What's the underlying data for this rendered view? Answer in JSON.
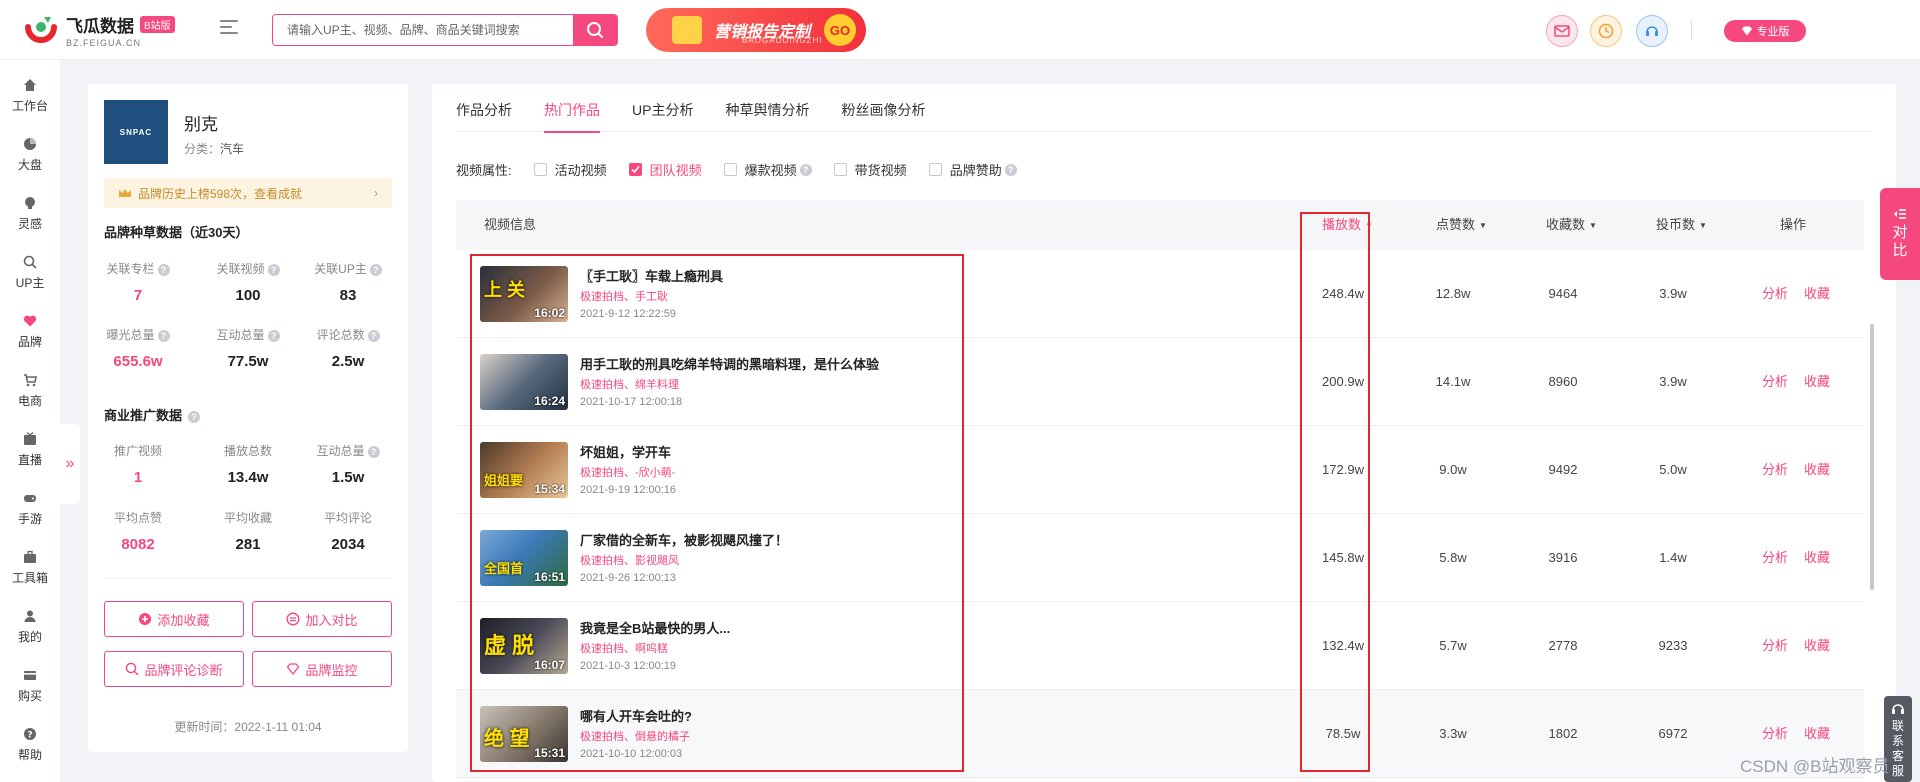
{
  "header": {
    "logo_title": "飞瓜数据",
    "logo_badge": "B站版",
    "logo_sub": "BZ.FEIGUA.CN",
    "search_placeholder": "请输入UP主、视频、品牌、商品关键词搜索",
    "banner_title": "营销报告定制",
    "banner_sub": "BAOGAODINGZHI",
    "banner_go": "GO",
    "pro_label": "专业版"
  },
  "leftnav": [
    {
      "label": "工作台",
      "icon": "home-icon"
    },
    {
      "label": "大盘",
      "icon": "pie-chart-icon"
    },
    {
      "label": "灵感",
      "icon": "bulb-icon"
    },
    {
      "label": "UP主",
      "icon": "search-person-icon"
    },
    {
      "label": "品牌",
      "icon": "heart-icon"
    },
    {
      "label": "电商",
      "icon": "cart-icon"
    },
    {
      "label": "直播",
      "icon": "live-icon"
    },
    {
      "label": "手游",
      "icon": "gamepad-icon"
    },
    {
      "label": "工具箱",
      "icon": "toolbox-icon"
    },
    {
      "label": "我的",
      "icon": "user-icon"
    },
    {
      "label": "购买",
      "icon": "card-icon"
    },
    {
      "label": "帮助",
      "icon": "help-icon"
    }
  ],
  "profile": {
    "logo_text": "SNPAC",
    "name": "别克",
    "category_label": "分类：",
    "category_value": "汽车",
    "rank_text": "品牌历史上榜598次，查看成就",
    "brand_section_title": "品牌种草数据（近30天）",
    "brand_stats": [
      {
        "label": "关联专栏",
        "value": "7",
        "pink": true,
        "help": true
      },
      {
        "label": "关联视频",
        "value": "100",
        "pink": false,
        "help": true
      },
      {
        "label": "关联UP主",
        "value": "83",
        "pink": false,
        "help": true
      },
      {
        "label": "曝光总量",
        "value": "655.6w",
        "pink": true,
        "help": true
      },
      {
        "label": "互动总量",
        "value": "77.5w",
        "pink": false,
        "help": true
      },
      {
        "label": "评论总数",
        "value": "2.5w",
        "pink": false,
        "help": true
      }
    ],
    "commerce_section_title": "商业推广数据",
    "commerce_stats": [
      {
        "label": "推广视频",
        "value": "1",
        "pink": true,
        "help": false
      },
      {
        "label": "播放总数",
        "value": "13.4w",
        "pink": false,
        "help": false
      },
      {
        "label": "互动总量",
        "value": "1.5w",
        "pink": false,
        "help": true
      },
      {
        "label": "平均点赞",
        "value": "8082",
        "pink": true,
        "help": false
      },
      {
        "label": "平均收藏",
        "value": "281",
        "pink": false,
        "help": false
      },
      {
        "label": "平均评论",
        "value": "2034",
        "pink": false,
        "help": false
      }
    ],
    "buttons": [
      "添加收藏",
      "加入对比",
      "品牌评论诊断",
      "品牌监控"
    ],
    "update_time": "更新时间：2022-1-11 01:04"
  },
  "main": {
    "tabs": [
      "作品分析",
      "热门作品",
      "UP主分析",
      "种草舆情分析",
      "粉丝画像分析"
    ],
    "active_tab": 1,
    "filter_label": "视频属性:",
    "filters": [
      {
        "label": "活动视频",
        "checked": false,
        "help": false
      },
      {
        "label": "团队视频",
        "checked": true,
        "help": false
      },
      {
        "label": "爆款视频",
        "checked": false,
        "help": true
      },
      {
        "label": "带货视频",
        "checked": false,
        "help": false
      },
      {
        "label": "品牌赞助",
        "checked": false,
        "help": true
      }
    ],
    "columns": {
      "info": "视频信息",
      "plays": "播放数",
      "likes": "点赞数",
      "favorites": "收藏数",
      "coins": "投币数",
      "actions": "操作"
    },
    "action_labels": {
      "analyze": "分析",
      "collect": "收藏"
    },
    "rows": [
      {
        "title": "〖手工耿〗车载上瘾刑具",
        "tags": "极速拍档、手工耿",
        "date": "2021-9-12 12:22:59",
        "duration": "16:02",
        "thumb_text": "上 关",
        "plays": "248.4w",
        "likes": "12.8w",
        "favorites": "9464",
        "coins": "3.9w"
      },
      {
        "title": "用手工耿的刑具吃绵羊特调的黑暗料理，是什么体验",
        "tags": "极速拍档、绵羊料理",
        "date": "2021-10-17 12:00:18",
        "duration": "16:24",
        "thumb_text": "",
        "plays": "200.9w",
        "likes": "14.1w",
        "favorites": "8960",
        "coins": "3.9w"
      },
      {
        "title": "坏姐姐，学开车",
        "tags": "极速拍档、-欣小萌-",
        "date": "2021-9-19 12:00:16",
        "duration": "15:34",
        "thumb_text": "姐姐要",
        "plays": "172.9w",
        "likes": "9.0w",
        "favorites": "9492",
        "coins": "5.0w"
      },
      {
        "title": "厂家借的全新车，被影视飓风撞了！",
        "tags": "极速拍档、影视飓风",
        "date": "2021-9-26 12:00:13",
        "duration": "16:51",
        "thumb_text": "全国首",
        "plays": "145.8w",
        "likes": "5.8w",
        "favorites": "3916",
        "coins": "1.4w"
      },
      {
        "title": "我竟是全B站最快的男人...",
        "tags": "极速拍档、啊呜糕",
        "date": "2021-10-3 12:00:19",
        "duration": "16:07",
        "thumb_text": "虚 脱",
        "plays": "132.4w",
        "likes": "5.7w",
        "favorites": "2778",
        "coins": "9233"
      },
      {
        "title": "哪有人开车会吐的?",
        "tags": "极速拍档、倒悬的橘子",
        "date": "2021-10-10 12:00:03",
        "duration": "15:31",
        "thumb_text": "绝 望",
        "plays": "78.5w",
        "likes": "3.3w",
        "favorites": "1802",
        "coins": "6972"
      }
    ]
  },
  "side": {
    "compare_label": "对比",
    "contact_label": "联系客服"
  },
  "watermark": "CSDN @B站观察员",
  "colors": {
    "accent": "#f5487f",
    "highlight_box": "#e0282e"
  }
}
